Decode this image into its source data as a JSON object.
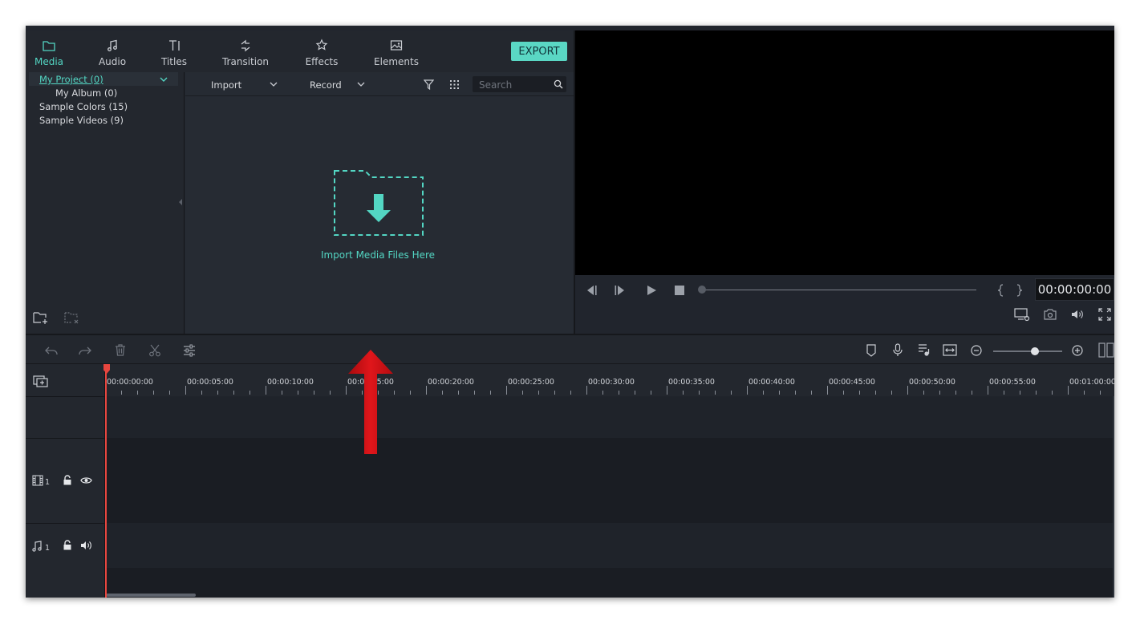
{
  "tabs": [
    {
      "label": "Media",
      "icon": "folder-icon",
      "active": true
    },
    {
      "label": "Audio",
      "icon": "music-note-icon",
      "active": false
    },
    {
      "label": "Titles",
      "icon": "text-icon",
      "active": false
    },
    {
      "label": "Transition",
      "icon": "transition-icon",
      "active": false
    },
    {
      "label": "Effects",
      "icon": "effects-icon",
      "active": false
    },
    {
      "label": "Elements",
      "icon": "image-icon",
      "active": false
    }
  ],
  "export_label": "EXPORT",
  "tree": {
    "my_project": "My Project (0)",
    "my_album": "My Album (0)",
    "sample_colors": "Sample Colors (15)",
    "sample_videos": "Sample Videos (9)"
  },
  "media_toolbar": {
    "import_label": "Import",
    "record_label": "Record",
    "search_placeholder": "Search"
  },
  "drop_zone_text": "Import Media Files Here",
  "preview": {
    "timecode": "00:00:00:00"
  },
  "ruler_ticks": [
    "00:00:00:00",
    "00:00:05:00",
    "00:00:10:00",
    "00:00:15:00",
    "00:00:20:00",
    "00:00:25:00",
    "00:00:30:00",
    "00:00:35:00",
    "00:00:40:00",
    "00:00:45:00",
    "00:00:50:00",
    "00:00:55:00",
    "00:01:00:00"
  ],
  "tracks": {
    "video_num": "1",
    "audio_num": "1"
  },
  "colors": {
    "accent": "#53d6c3",
    "playhead": "#e8463f",
    "annotation_arrow": "#e0161b"
  }
}
